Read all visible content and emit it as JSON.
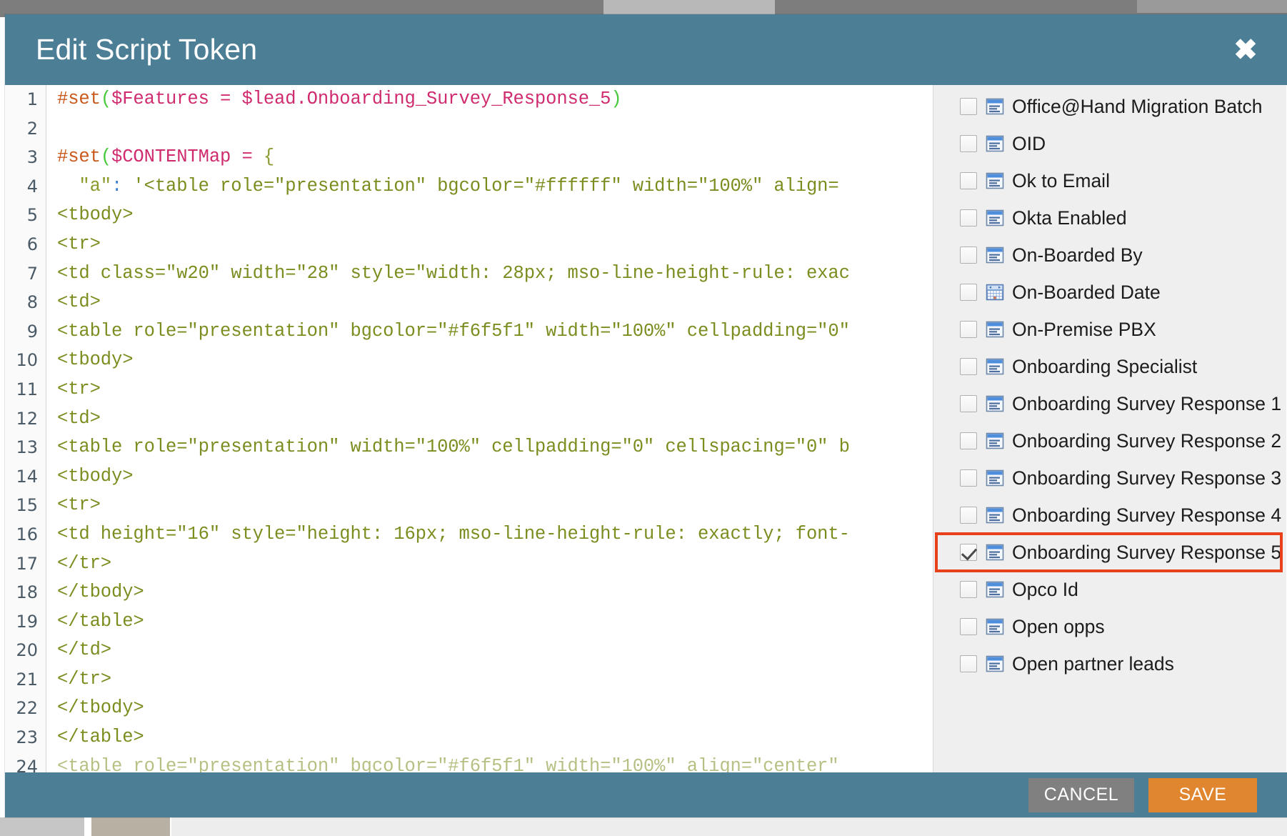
{
  "window": {
    "title": "Edit Script Token",
    "close_icon": "close-icon",
    "close_glyph": "✖",
    "header_color": "#4c7f96"
  },
  "editor": {
    "name": "script-token-editor",
    "language": "velocity-html",
    "first_line_number": 1,
    "lines": [
      {
        "n": "1",
        "tokens": [
          {
            "t": "#set",
            "c": "tok-dir"
          },
          {
            "t": "(",
            "c": "tok-paren"
          },
          {
            "t": "$Features ",
            "c": "tok-var"
          },
          {
            "t": "= ",
            "c": "tok-op"
          },
          {
            "t": "$lead.Onboarding_Survey_Response_5",
            "c": "tok-var"
          },
          {
            "t": ")",
            "c": "tok-paren"
          }
        ]
      },
      {
        "n": "2",
        "tokens": []
      },
      {
        "n": "3",
        "tokens": [
          {
            "t": "#set",
            "c": "tok-dir"
          },
          {
            "t": "(",
            "c": "tok-paren"
          },
          {
            "t": "$CONTENTMap ",
            "c": "tok-var"
          },
          {
            "t": "= ",
            "c": "tok-op"
          },
          {
            "t": "{",
            "c": "tok-brace"
          }
        ]
      },
      {
        "n": "4",
        "tokens": [
          {
            "t": "  \"a\"",
            "c": "tok-str"
          },
          {
            "t": ":",
            "c": "tok-colon"
          },
          {
            "t": " '<table role=\"presentation\" bgcolor=\"#ffffff\" width=\"100%\" align=",
            "c": "tok-tag"
          }
        ]
      },
      {
        "n": "5",
        "tokens": [
          {
            "t": "<tbody>",
            "c": "tok-tag"
          }
        ]
      },
      {
        "n": "6",
        "tokens": [
          {
            "t": "<tr>",
            "c": "tok-tag"
          }
        ]
      },
      {
        "n": "7",
        "tokens": [
          {
            "t": "<td class=\"w20\" width=\"28\" style=\"width: 28px; mso-line-height-rule: exac",
            "c": "tok-tag"
          }
        ]
      },
      {
        "n": "8",
        "tokens": [
          {
            "t": "<td>",
            "c": "tok-tag"
          }
        ]
      },
      {
        "n": "9",
        "tokens": [
          {
            "t": "<table role=\"presentation\" bgcolor=\"#f6f5f1\" width=\"100%\" cellpadding=\"0\"",
            "c": "tok-tag"
          }
        ]
      },
      {
        "n": "10",
        "tokens": [
          {
            "t": "<tbody>",
            "c": "tok-tag"
          }
        ]
      },
      {
        "n": "11",
        "tokens": [
          {
            "t": "<tr>",
            "c": "tok-tag"
          }
        ]
      },
      {
        "n": "12",
        "tokens": [
          {
            "t": "<td>",
            "c": "tok-tag"
          }
        ]
      },
      {
        "n": "13",
        "tokens": [
          {
            "t": "<table role=\"presentation\" width=\"100%\" cellpadding=\"0\" cellspacing=\"0\" b",
            "c": "tok-tag"
          }
        ]
      },
      {
        "n": "14",
        "tokens": [
          {
            "t": "<tbody>",
            "c": "tok-tag"
          }
        ]
      },
      {
        "n": "15",
        "tokens": [
          {
            "t": "<tr>",
            "c": "tok-tag"
          }
        ]
      },
      {
        "n": "16",
        "tokens": [
          {
            "t": "<td height=\"16\" style=\"height: 16px; mso-line-height-rule: exactly; font-",
            "c": "tok-tag"
          }
        ]
      },
      {
        "n": "17",
        "tokens": [
          {
            "t": "</tr>",
            "c": "tok-tag"
          }
        ]
      },
      {
        "n": "18",
        "tokens": [
          {
            "t": "</tbody>",
            "c": "tok-tag"
          }
        ]
      },
      {
        "n": "19",
        "tokens": [
          {
            "t": "</table>",
            "c": "tok-tag"
          }
        ]
      },
      {
        "n": "20",
        "tokens": [
          {
            "t": "</td>",
            "c": "tok-tag"
          }
        ]
      },
      {
        "n": "21",
        "tokens": [
          {
            "t": "</tr>",
            "c": "tok-tag"
          }
        ]
      },
      {
        "n": "22",
        "tokens": [
          {
            "t": "</tbody>",
            "c": "tok-tag"
          }
        ]
      },
      {
        "n": "23",
        "tokens": [
          {
            "t": "</table>",
            "c": "tok-tag"
          }
        ]
      },
      {
        "n": "24",
        "tokens": [
          {
            "t": "<table role=\"presentation\" bgcolor=\"#f6f5f1\" width=\"100%\" align=\"center\"",
            "c": "tok-tag"
          }
        ],
        "clipped": true
      }
    ]
  },
  "field_panel": {
    "name": "token-field-list",
    "items": [
      {
        "label": "Office@Hand Migration Batch",
        "icon": "text-field-icon",
        "checked": false,
        "highlighted": false
      },
      {
        "label": "OID",
        "icon": "text-field-icon",
        "checked": false,
        "highlighted": false
      },
      {
        "label": "Ok to Email",
        "icon": "text-field-icon",
        "checked": false,
        "highlighted": false
      },
      {
        "label": "Okta Enabled",
        "icon": "text-field-icon",
        "checked": false,
        "highlighted": false
      },
      {
        "label": "On-Boarded By",
        "icon": "text-field-icon",
        "checked": false,
        "highlighted": false
      },
      {
        "label": "On-Boarded Date",
        "icon": "date-field-icon",
        "checked": false,
        "highlighted": false
      },
      {
        "label": "On-Premise PBX",
        "icon": "text-field-icon",
        "checked": false,
        "highlighted": false
      },
      {
        "label": "Onboarding Specialist",
        "icon": "text-field-icon",
        "checked": false,
        "highlighted": false
      },
      {
        "label": "Onboarding Survey Response 1",
        "icon": "text-field-icon",
        "checked": false,
        "highlighted": false
      },
      {
        "label": "Onboarding Survey Response 2",
        "icon": "text-field-icon",
        "checked": false,
        "highlighted": false
      },
      {
        "label": "Onboarding Survey Response 3",
        "icon": "text-field-icon",
        "checked": false,
        "highlighted": false
      },
      {
        "label": "Onboarding Survey Response 4",
        "icon": "text-field-icon",
        "checked": false,
        "highlighted": false
      },
      {
        "label": "Onboarding Survey Response 5",
        "icon": "text-field-icon",
        "checked": true,
        "highlighted": true
      },
      {
        "label": "Opco Id",
        "icon": "text-field-icon",
        "checked": false,
        "highlighted": false
      },
      {
        "label": "Open opps",
        "icon": "text-field-icon",
        "checked": false,
        "highlighted": false
      },
      {
        "label": "Open partner leads",
        "icon": "text-field-icon",
        "checked": false,
        "highlighted": false
      }
    ],
    "highlight_color": "#e8411a"
  },
  "footer": {
    "cancel_label": "CANCEL",
    "save_label": "SAVE",
    "cancel_color": "#808080",
    "save_color": "#e0862e"
  }
}
